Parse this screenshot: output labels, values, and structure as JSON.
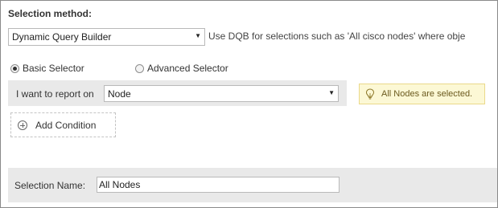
{
  "selection_method": {
    "label": "Selection method:",
    "selected": "Dynamic Query Builder",
    "hint": "Use DQB for selections such as 'All cisco nodes' where obje"
  },
  "selector_type": {
    "basic_label": "Basic Selector",
    "advanced_label": "Advanced Selector",
    "selected": "Basic Selector"
  },
  "report": {
    "label": "I want to report on",
    "selected": "Node"
  },
  "alert": {
    "text": "All Nodes are selected."
  },
  "add_condition": {
    "label": "Add Condition"
  },
  "selection_name": {
    "label": "Selection Name:",
    "value": "All Nodes"
  },
  "icons": {
    "dropdown_arrow": "triangle-down",
    "alert": "lightbulb-icon",
    "add": "circle-plus-icon"
  },
  "colors": {
    "alert_bg": "#fcf8d5",
    "alert_border": "#ead98a",
    "alert_text": "#6b5a1e",
    "bar_bg": "#e9e9e9"
  }
}
